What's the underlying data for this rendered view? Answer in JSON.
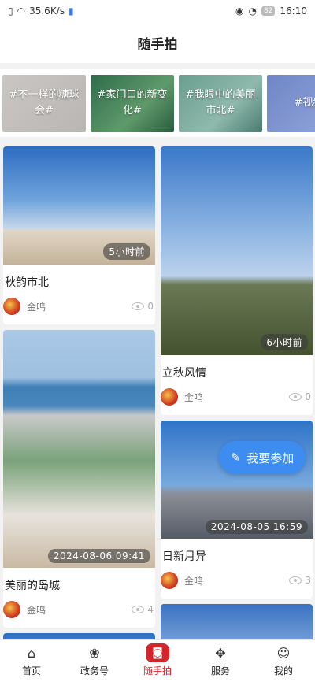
{
  "status": {
    "speed": "35.6K/s",
    "battery": "82",
    "time": "16:10"
  },
  "header": {
    "title": "随手拍"
  },
  "topics": [
    "#不一样的糖球会#",
    "#家门口的新变化#",
    "#我眼中的美丽市北#",
    "#视频"
  ],
  "feed": {
    "left": [
      {
        "title": "秋韵市北",
        "author": "金鸣",
        "views": "0",
        "time": "5小时前"
      },
      {
        "title": "美丽的岛城",
        "author": "金鸣",
        "views": "4",
        "time": "2024-08-06  09:41"
      }
    ],
    "right": [
      {
        "title": "立秋风情",
        "author": "金鸣",
        "views": "0",
        "time": "6小时前"
      },
      {
        "title": "日新月异",
        "author": "金鸣",
        "views": "3",
        "time": "2024-08-05  16:59"
      }
    ]
  },
  "join_button": {
    "label": "我要参加"
  },
  "tabs": [
    {
      "label": "首页",
      "icon": "home-icon"
    },
    {
      "label": "政务号",
      "icon": "government-icon"
    },
    {
      "label": "随手拍",
      "icon": "camera-icon"
    },
    {
      "label": "服务",
      "icon": "services-icon"
    },
    {
      "label": "我的",
      "icon": "profile-icon"
    }
  ],
  "colors": {
    "accent": "#d4252b",
    "join_button": "#3d8df0"
  }
}
